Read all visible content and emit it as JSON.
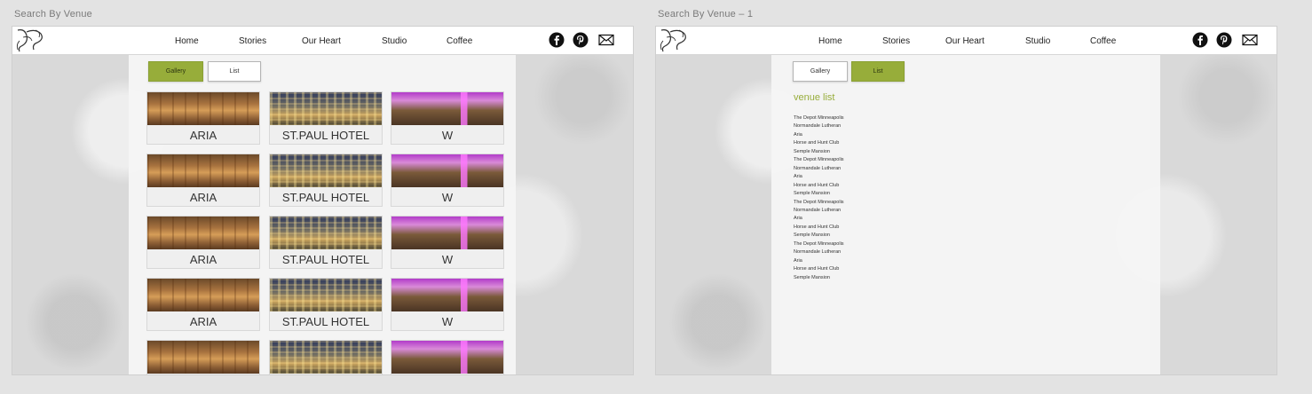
{
  "artboards": [
    {
      "label": "Search By Venue",
      "nav": [
        "Home",
        "Stories",
        "Our Heart",
        "Studio",
        "Coffee"
      ],
      "tabs": {
        "gallery": "Gallery",
        "list": "List",
        "active": "gallery"
      },
      "venue_rows": [
        [
          "ARIA",
          "ST.PAUL HOTEL",
          "W"
        ],
        [
          "ARIA",
          "ST.PAUL HOTEL",
          "W"
        ],
        [
          "ARIA",
          "ST.PAUL HOTEL",
          "W"
        ],
        [
          "ARIA",
          "ST.PAUL HOTEL",
          "W"
        ],
        [
          "",
          "",
          ""
        ]
      ]
    },
    {
      "label": "Search By Venue – 1",
      "nav": [
        "Home",
        "Stories",
        "Our Heart",
        "Studio",
        "Coffee"
      ],
      "tabs": {
        "gallery": "Gallery",
        "list": "List",
        "active": "list"
      },
      "venue_list_title": "venue list",
      "venue_list": [
        "The Depot Minneapolis",
        "Normandale Lutheran",
        "Aria",
        "Horse and Hunt Club",
        "Semple Mansion",
        "The Depot Minneapolis",
        "Normandale Lutheran",
        "Aria",
        "Horse and Hunt Club",
        "Semple Mansion",
        "The Depot Minneapolis",
        "Normandale Lutheran",
        "Aria",
        "Horse and Hunt Club",
        "Semple Mansion",
        "The Depot Minneapolis",
        "Normandale Lutheran",
        "Aria",
        "Horse and Hunt Club",
        "Semple Mansion"
      ]
    }
  ],
  "icons": [
    "logo-icon",
    "facebook-icon",
    "pinterest-icon",
    "email-icon"
  ],
  "colors": {
    "accent": "#97ad3a",
    "canvas": "#e3e3e3",
    "navbar": "#ffffff"
  }
}
